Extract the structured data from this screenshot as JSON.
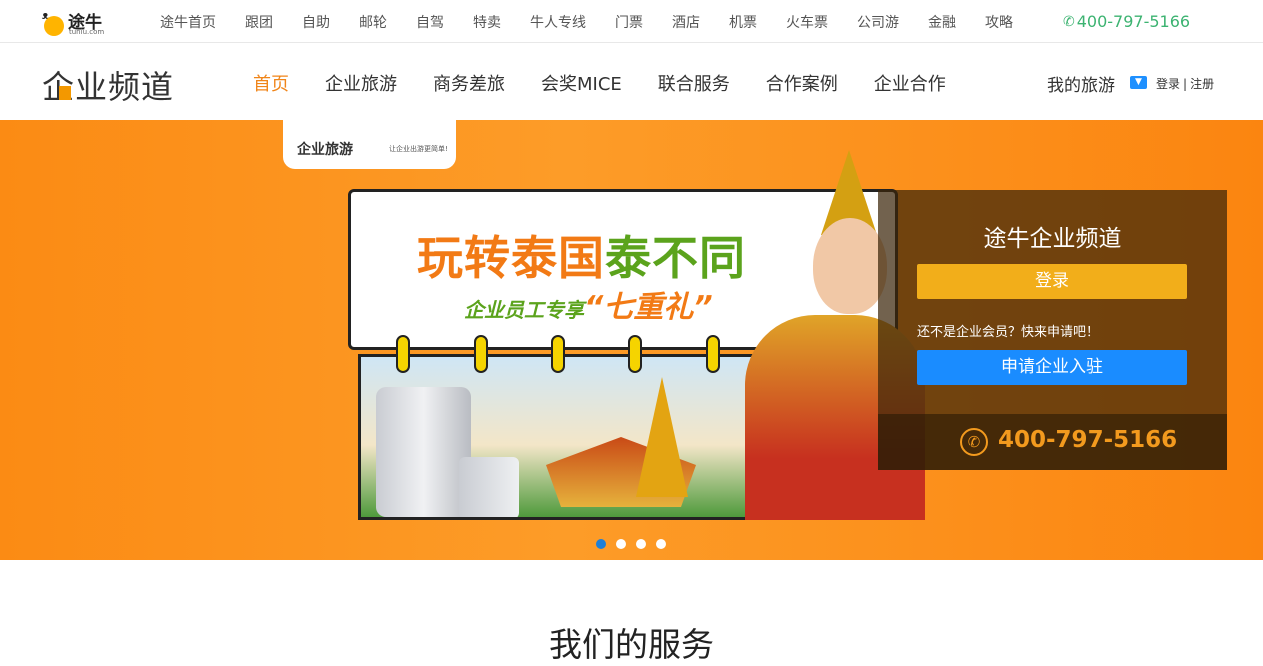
{
  "brand": {
    "name": "途牛",
    "domain": "tuniu.com"
  },
  "topnav": [
    "途牛首页",
    "跟团",
    "自助",
    "邮轮",
    "自驾",
    "特卖",
    "牛人专线",
    "门票",
    "酒店",
    "机票",
    "火车票",
    "公司游",
    "金融",
    "攻略"
  ],
  "top_phone": "400-797-5166",
  "channel": {
    "title": "企业频道"
  },
  "menu": [
    "首页",
    "企业旅游",
    "商务差旅",
    "会奖MICE",
    "联合服务",
    "合作案例",
    "企业合作"
  ],
  "user": {
    "my_trip": "我的旅游",
    "login": "登录",
    "sep": "|",
    "register": "注册"
  },
  "banner": {
    "badge_title": "企业旅游",
    "badge_slogan": "让企业出游更简单!",
    "headline_a": "玩转泰国",
    "headline_b": "泰不同",
    "subline": "企业员工专享",
    "subline_em": "“七重礼”",
    "slide_count": 4,
    "active_slide": 1
  },
  "panel": {
    "title": "途牛企业频道",
    "login_label": "登录",
    "notyet": "还不是企业会员？快来申请吧！",
    "apply_label": "申请企业入驻",
    "phone": "400-797-5166"
  },
  "section_title": "我们的服务",
  "colors": {
    "accent": "#f08519",
    "banner": "#fb8b14",
    "login": "#f2ae1a",
    "apply": "#1a8cff",
    "phone_green": "#3cb371"
  }
}
